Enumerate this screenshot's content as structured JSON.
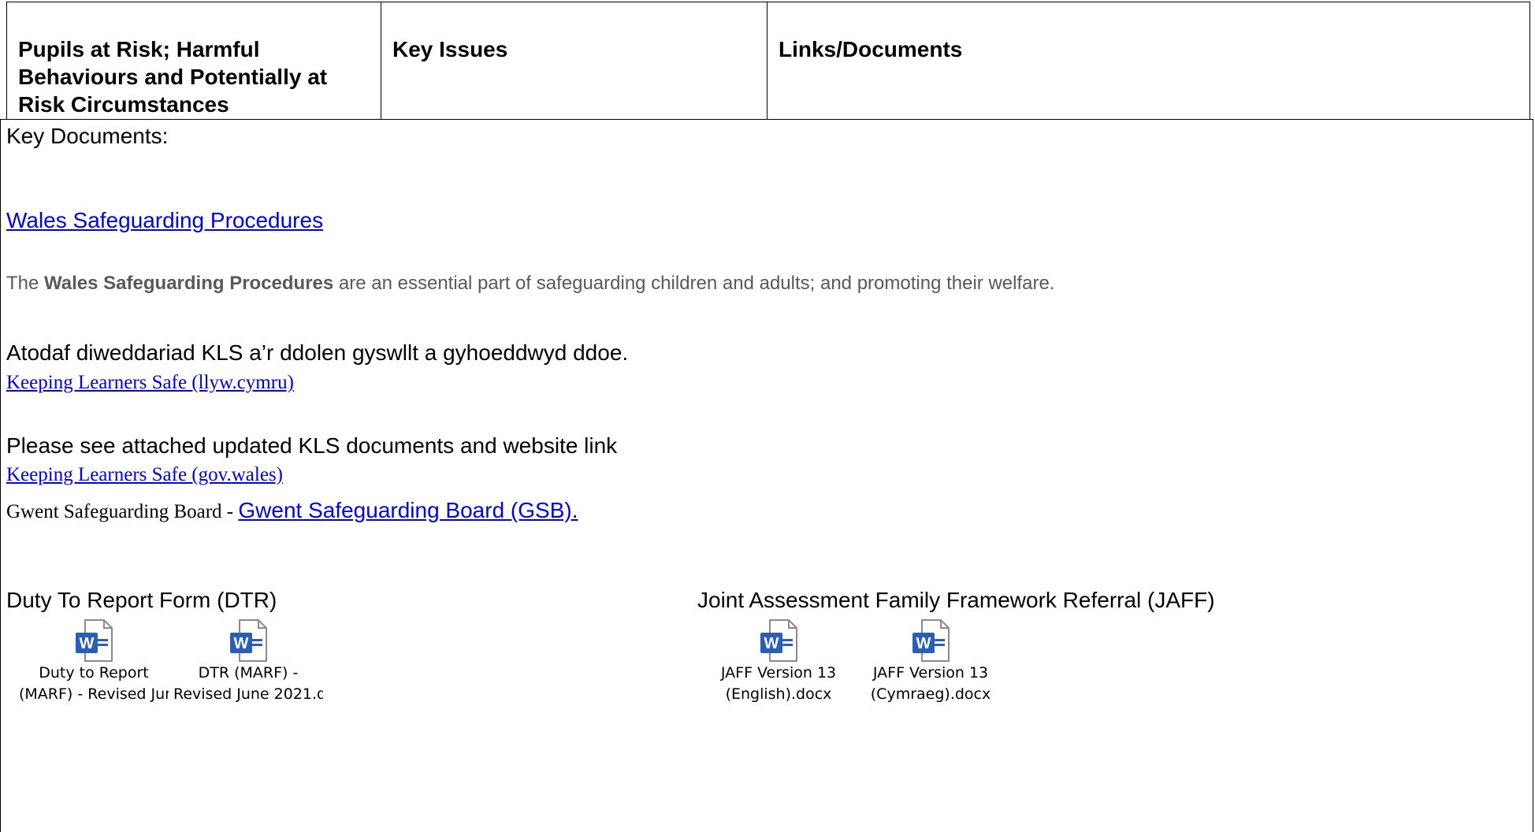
{
  "header": {
    "col1": "Pupils at Risk;  Harmful Behaviours and Potentially at Risk Circumstances",
    "col2": "Key Issues",
    "col3": "Links/Documents"
  },
  "content": {
    "key_documents_label": "Key Documents:",
    "wales_link": "Wales Safeguarding Procedures",
    "wales_desc_bold": "Wales Safeguarding Procedures",
    "wales_desc_prefix": "The ",
    "wales_desc_rest": " are an essential part of safeguarding children and adults; and promoting their welfare.",
    "kls_welsh_text": "Atodaf diweddariad KLS a’r ddolen gyswllt a gyhoeddwyd ddoe.",
    "kls_welsh_link": "Keeping Learners Safe (llyw.cymru)",
    "kls_english_text": "Please see attached updated KLS documents and website link",
    "kls_english_link": "Keeping Learners Safe (gov.wales)",
    "gwent_prefix": "Gwent Safeguarding Board - ",
    "gwent_link": "Gwent Safeguarding Board (GSB).",
    "dtr_heading": "Duty To Report Form (DTR)",
    "jaff_heading": "Joint Assessment Family Framework Referral (JAFF)"
  },
  "attachments": [
    {
      "line1": "Duty to Report",
      "line2": "(MARF) - Revised Jur",
      "icon": "word-doc-icon"
    },
    {
      "line1": "DTR (MARF) -",
      "line2": "Revised June 2021.d",
      "icon": "word-doc-icon"
    },
    {
      "line1": "JAFF Version 13",
      "line2": "(English).docx",
      "icon": "word-doc-icon"
    },
    {
      "line1": "JAFF Version 13",
      "line2": "(Cymraeg).docx",
      "icon": "word-doc-icon"
    }
  ],
  "colors": {
    "link": "#0000ee",
    "word_blue": "#2b5eb8"
  }
}
